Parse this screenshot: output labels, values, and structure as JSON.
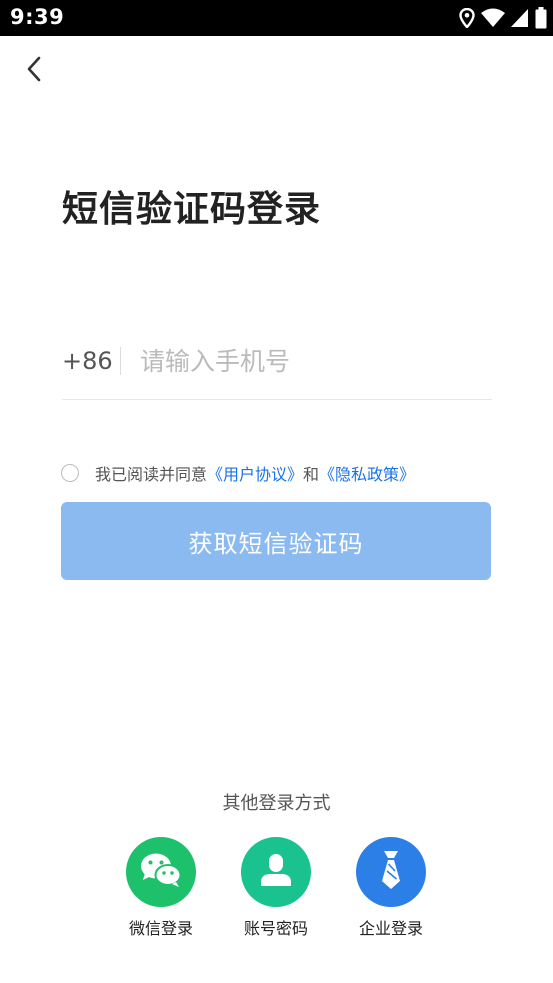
{
  "status_bar": {
    "time": "9:39",
    "icons": [
      "location-icon",
      "wifi-icon",
      "signal-icon",
      "battery-icon"
    ]
  },
  "header": {
    "back_icon": "chevron-left-icon"
  },
  "page": {
    "title": "短信验证码登录"
  },
  "phone": {
    "country_code": "+86",
    "placeholder": "请输入手机号",
    "value": ""
  },
  "agreement": {
    "checked": false,
    "prefix": "我已阅读并同意",
    "user_agreement": "《用户协议》",
    "conjunction": "和",
    "privacy_policy": "《隐私政策》"
  },
  "sms_button": {
    "label": "获取短信验证码"
  },
  "other_login": {
    "title": "其他登录方式",
    "options": [
      {
        "label": "微信登录",
        "icon": "wechat-icon",
        "color": "#1ec16b"
      },
      {
        "label": "账号密码",
        "icon": "user-icon",
        "color": "#19c28f"
      },
      {
        "label": "企业登录",
        "icon": "necktie-icon",
        "color": "#2b7fe6"
      }
    ]
  },
  "colors": {
    "accent": "#1a73e8",
    "button_disabled": "#8bbaf0",
    "title_text": "#222222",
    "placeholder": "#bbbbbb"
  }
}
